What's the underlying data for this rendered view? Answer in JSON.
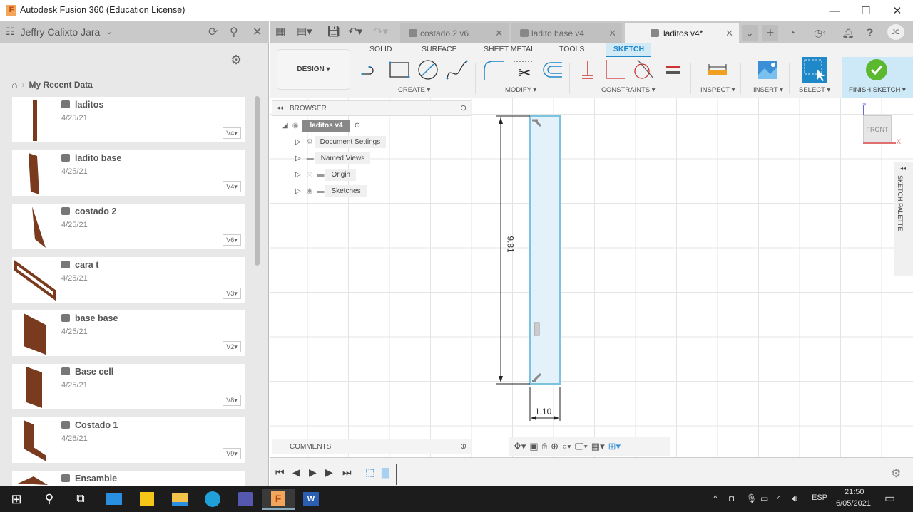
{
  "window": {
    "title": "Autodesk Fusion 360 (Education License)",
    "logo": "F",
    "controls": {
      "minimize": "—",
      "maximize": "☐",
      "close": "✕"
    }
  },
  "left_panel": {
    "user": "Jeffry Calixto Jara",
    "breadcrumb": "My Recent Data",
    "items": [
      {
        "name": "laditos",
        "date": "4/25/21",
        "version": "V4▾"
      },
      {
        "name": "ladito base",
        "date": "4/25/21",
        "version": "V4▾"
      },
      {
        "name": "costado 2",
        "date": "4/25/21",
        "version": "V6▾"
      },
      {
        "name": "cara t",
        "date": "4/25/21",
        "version": "V3▾"
      },
      {
        "name": "base base",
        "date": "4/25/21",
        "version": "V2▾"
      },
      {
        "name": "Base cell",
        "date": "4/25/21",
        "version": "V8▾"
      },
      {
        "name": "Costado 1",
        "date": "4/26/21",
        "version": "V9▾"
      },
      {
        "name": "Ensamble",
        "date": "",
        "version": ""
      }
    ]
  },
  "tabs": [
    {
      "label": "costado 2 v6",
      "active": false
    },
    {
      "label": "ladito base v4",
      "active": false
    },
    {
      "label": "laditos v4*",
      "active": true
    }
  ],
  "tab_bar": {
    "jobs_count": "1",
    "avatar": "JC"
  },
  "toolbar": {
    "workspace": "DESIGN ▾",
    "tabs": [
      "SOLID",
      "SURFACE",
      "SHEET METAL",
      "TOOLS",
      "SKETCH"
    ],
    "active_tab": "SKETCH",
    "groups": {
      "create": "CREATE ▾",
      "modify": "MODIFY ▾",
      "constraints": "CONSTRAINTS ▾",
      "inspect": "INSPECT ▾",
      "insert": "INSERT ▾",
      "select": "SELECT ▾",
      "finish": "FINISH SKETCH ▾"
    },
    "accent": "#1e88c9",
    "finish_color": "#5cb82e"
  },
  "browser": {
    "title": "BROWSER",
    "root": "laditos v4",
    "nodes": [
      "Document Settings",
      "Named Views",
      "Origin",
      "Sketches"
    ]
  },
  "comments": {
    "title": "COMMENTS"
  },
  "canvas": {
    "dim_height": "9.81",
    "dim_width": "1.10",
    "viewcube": "FRONT",
    "axis_z": "Z",
    "axis_x": "X",
    "sketch_palette": "SKETCH PALETTE"
  },
  "taskbar": {
    "lang": "ESP",
    "time": "21:50",
    "date": "6/05/2021"
  }
}
